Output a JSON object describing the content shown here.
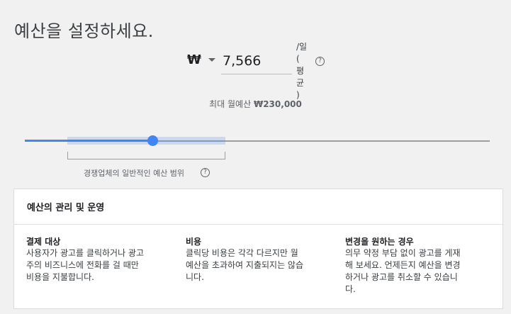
{
  "page": {
    "title": "예산을 설정하세요."
  },
  "budget": {
    "currency_symbol": "₩",
    "value": "7,566",
    "period_line1": "/일",
    "period_line2": "(",
    "period_line3": "평균",
    "period_line4": ")",
    "help_glyph": "?",
    "monthly_label": "최대 월예산",
    "monthly_value": "₩230,000"
  },
  "slider": {
    "level": 0.28,
    "range_label": "경쟁업체의 일반적인 예산 범위",
    "help_glyph": "?"
  },
  "info_card": {
    "heading": "예산의 관리 및 운영",
    "columns": [
      {
        "title": "결제 대상",
        "lines": [
          "사용자가 광고를 클릭하거나 광고",
          "주의 비즈니스에 전화를 걸 때만",
          "비용을 지불합니다."
        ]
      },
      {
        "title": "비용",
        "lines": [
          "클릭당 비용은 각각 다르지만 월",
          "예산을 초과하여 지출되지는 않습",
          "니다."
        ]
      },
      {
        "title": "변경을 원하는 경우",
        "lines": [
          "의무 약정 부담 없이 광고를 게재",
          "해 보세요. 언제든지 예산을 변경",
          "하거나 광고를 취소할 수 있습니",
          "다."
        ]
      }
    ]
  },
  "colors": {
    "accent": "#4285f4",
    "track": "#9e9e9e",
    "background": "#f1f1f1"
  }
}
